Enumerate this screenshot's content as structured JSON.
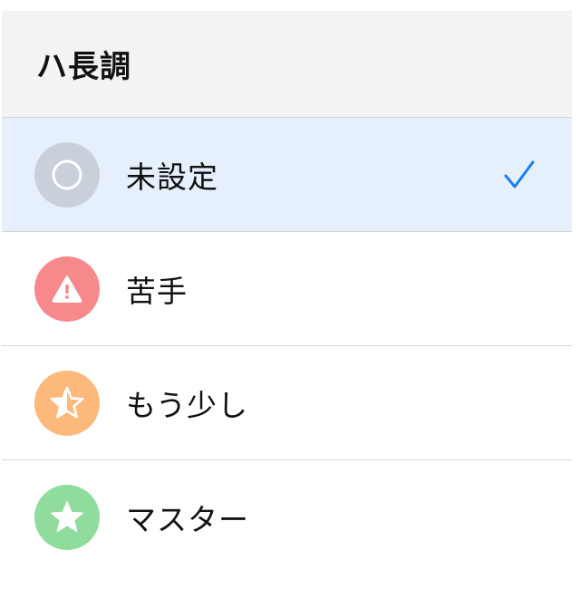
{
  "header": {
    "title": "ハ長調"
  },
  "options": [
    {
      "label": "未設定",
      "icon": "circle-outline-icon",
      "color": "#c9d0da",
      "selected": true
    },
    {
      "label": "苦手",
      "icon": "warning-icon",
      "color": "#f7888c",
      "selected": false
    },
    {
      "label": "もう少し",
      "icon": "star-outline-icon",
      "color": "#fdb87c",
      "selected": false
    },
    {
      "label": "マスター",
      "icon": "star-icon",
      "color": "#8fdc9d",
      "selected": false
    }
  ],
  "accent_color": "#1a7ff0"
}
